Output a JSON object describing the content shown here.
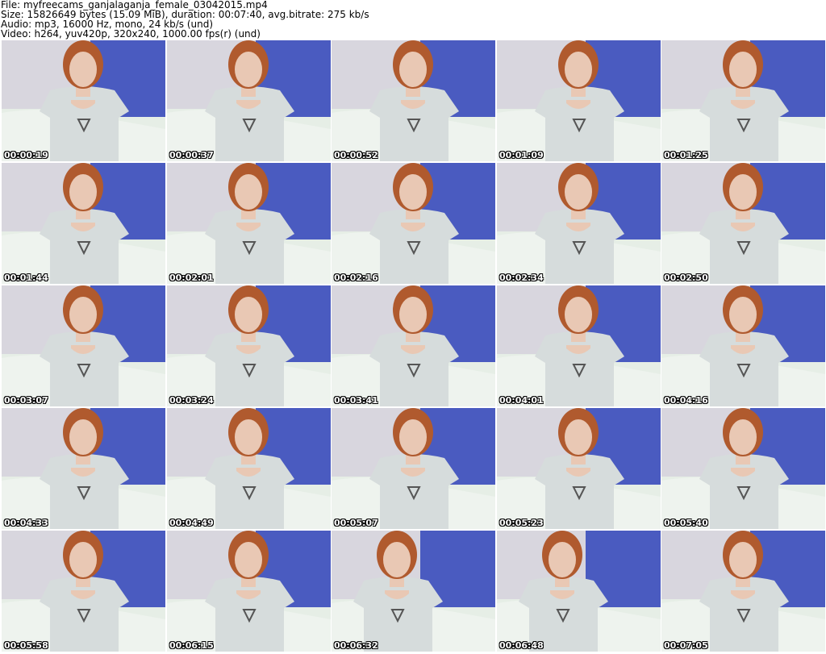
{
  "header": {
    "file": "File: myfreecams_ganjalaganja_female_03042015.mp4",
    "size": "Size: 15826649 bytes (15.09 MiB), duration: 00:07:40, avg.bitrate: 275 kb/s",
    "audio": "Audio: mp3, 16000 Hz, mono, 24 kb/s (und)",
    "video": "Video: h264, yuv420p, 320x240, 1000.00 fps(r) (und)"
  },
  "thumbnails": [
    "00:00:19",
    "00:00:37",
    "00:00:52",
    "00:01:09",
    "00:01:25",
    "00:01:44",
    "00:02:01",
    "00:02:16",
    "00:02:34",
    "00:02:50",
    "00:03:07",
    "00:03:24",
    "00:03:41",
    "00:04:01",
    "00:04:16",
    "00:04:33",
    "00:04:49",
    "00:05:07",
    "00:05:23",
    "00:05:40",
    "00:05:58",
    "00:06:15",
    "00:06:32",
    "00:06:48",
    "00:07:05"
  ],
  "colors": {
    "wall_blue": "#4a5bc0",
    "curtain": "#d8d6de",
    "couch": "#e6eee6",
    "shirt": "#d6dcdc",
    "hair": "#b05a2e",
    "skin": "#e9c8b4"
  }
}
